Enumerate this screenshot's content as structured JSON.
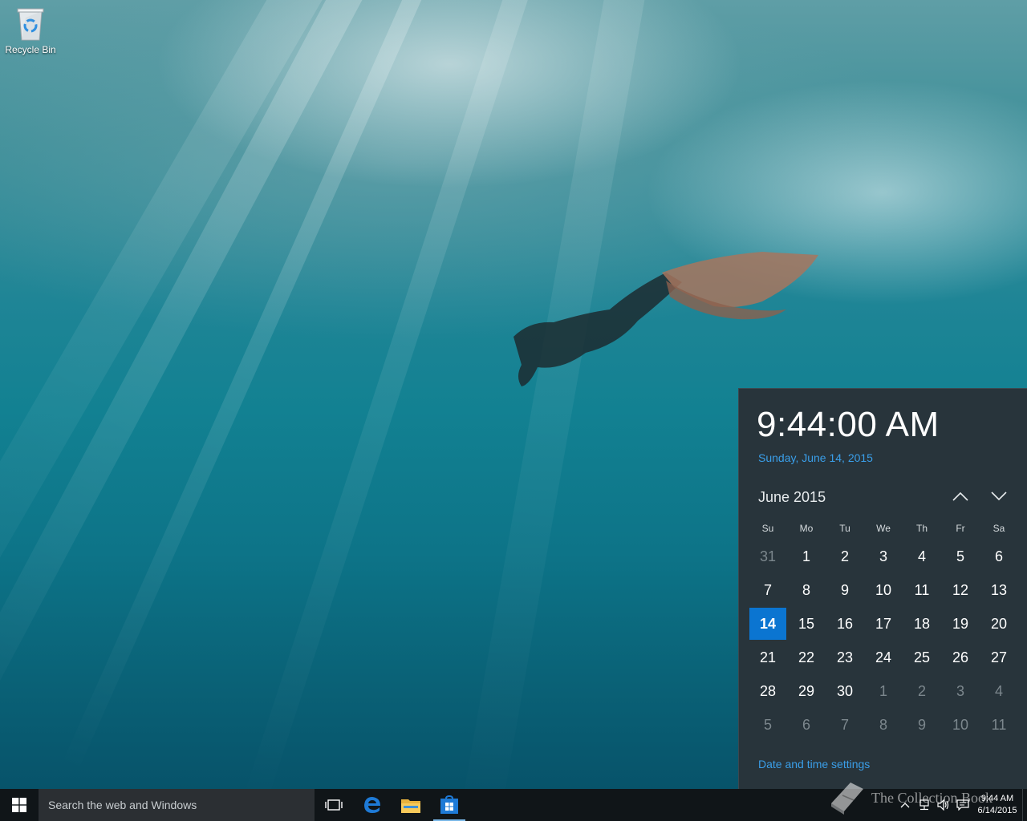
{
  "desktop": {
    "icons": [
      {
        "label": "Recycle Bin",
        "icon": "recycle-bin-icon"
      }
    ]
  },
  "flyout": {
    "time": "9:44:00 AM",
    "date": "Sunday, June 14, 2015",
    "month_label": "June 2015",
    "prev_icon": "chevron-up-icon",
    "next_icon": "chevron-down-icon",
    "weekdays": [
      "Su",
      "Mo",
      "Tu",
      "We",
      "Th",
      "Fr",
      "Sa"
    ],
    "weeks": [
      [
        {
          "d": "31",
          "o": true
        },
        {
          "d": "1"
        },
        {
          "d": "2"
        },
        {
          "d": "3"
        },
        {
          "d": "4"
        },
        {
          "d": "5"
        },
        {
          "d": "6"
        }
      ],
      [
        {
          "d": "7"
        },
        {
          "d": "8"
        },
        {
          "d": "9"
        },
        {
          "d": "10"
        },
        {
          "d": "11"
        },
        {
          "d": "12"
        },
        {
          "d": "13"
        }
      ],
      [
        {
          "d": "14",
          "today": true
        },
        {
          "d": "15"
        },
        {
          "d": "16"
        },
        {
          "d": "17"
        },
        {
          "d": "18"
        },
        {
          "d": "19"
        },
        {
          "d": "20"
        }
      ],
      [
        {
          "d": "21"
        },
        {
          "d": "22"
        },
        {
          "d": "23"
        },
        {
          "d": "24"
        },
        {
          "d": "25"
        },
        {
          "d": "26"
        },
        {
          "d": "27"
        }
      ],
      [
        {
          "d": "28"
        },
        {
          "d": "29"
        },
        {
          "d": "30"
        },
        {
          "d": "1",
          "o": true
        },
        {
          "d": "2",
          "o": true
        },
        {
          "d": "3",
          "o": true
        },
        {
          "d": "4",
          "o": true
        }
      ],
      [
        {
          "d": "5",
          "o": true
        },
        {
          "d": "6",
          "o": true
        },
        {
          "d": "7",
          "o": true
        },
        {
          "d": "8",
          "o": true
        },
        {
          "d": "9",
          "o": true
        },
        {
          "d": "10",
          "o": true
        },
        {
          "d": "11",
          "o": true
        }
      ]
    ],
    "settings_link": "Date and time settings",
    "accent_color": "#0b75d1",
    "link_color": "#3a9ee8"
  },
  "taskbar": {
    "search_placeholder": "Search the web and Windows",
    "pinned": [
      {
        "name": "task-view",
        "icon": "task-view-icon"
      },
      {
        "name": "edge",
        "icon": "edge-icon"
      },
      {
        "name": "file-explorer",
        "icon": "folder-icon"
      },
      {
        "name": "store",
        "icon": "store-icon"
      }
    ],
    "tray": {
      "time": "9:44 AM",
      "date": "6/14/2015"
    }
  },
  "watermark": {
    "text": "The Collection Book"
  }
}
